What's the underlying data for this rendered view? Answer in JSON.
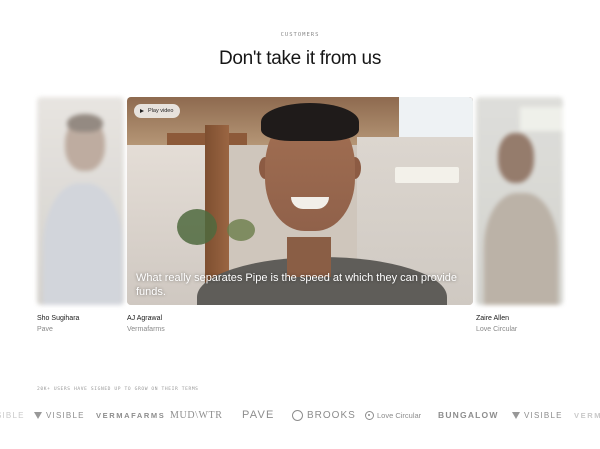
{
  "section": {
    "eyebrow": "CUSTOMERS",
    "headline": "Don't take it from us"
  },
  "testimonials": [
    {
      "name": "Sho Sugihara",
      "company": "Pave",
      "state": "blurred"
    },
    {
      "name": "AJ Agrawal",
      "company": "Vermafarms",
      "state": "active",
      "play_label": "Play video",
      "caption": "What really separates Pipe is the speed at which they can provide funds."
    },
    {
      "name": "Zaire Allen",
      "company": "Love Circular",
      "state": "blurred"
    }
  ],
  "social_proof": {
    "stat": "20K+ USERS HAVE SIGNED UP TO GROW ON THEIR TERMS"
  },
  "logos": [
    {
      "label": "VISIBLE",
      "icon": "visible-v-icon",
      "faded": true
    },
    {
      "label": "VISIBLE",
      "icon": "visible-v-icon",
      "faded": false
    },
    {
      "label": "VERMAFARMS",
      "faded": false
    },
    {
      "label": "MUD\\WTR",
      "faded": false
    },
    {
      "label": "PAVE",
      "faded": false
    },
    {
      "label": "BROOKS",
      "icon": "brooks-ring-icon",
      "faded": false
    },
    {
      "label": "Love Circular",
      "icon": "love-circular-icon",
      "faded": false
    },
    {
      "label": "BUNGALOW",
      "faded": false
    },
    {
      "label": "VISIBLE",
      "icon": "visible-v-icon",
      "faded": false
    },
    {
      "label": "VERMA",
      "faded": true
    }
  ],
  "colors": {
    "background": "#ffffff",
    "headline": "#161616",
    "muted": "#8a8a8a",
    "logo": "#8d8d8d"
  }
}
